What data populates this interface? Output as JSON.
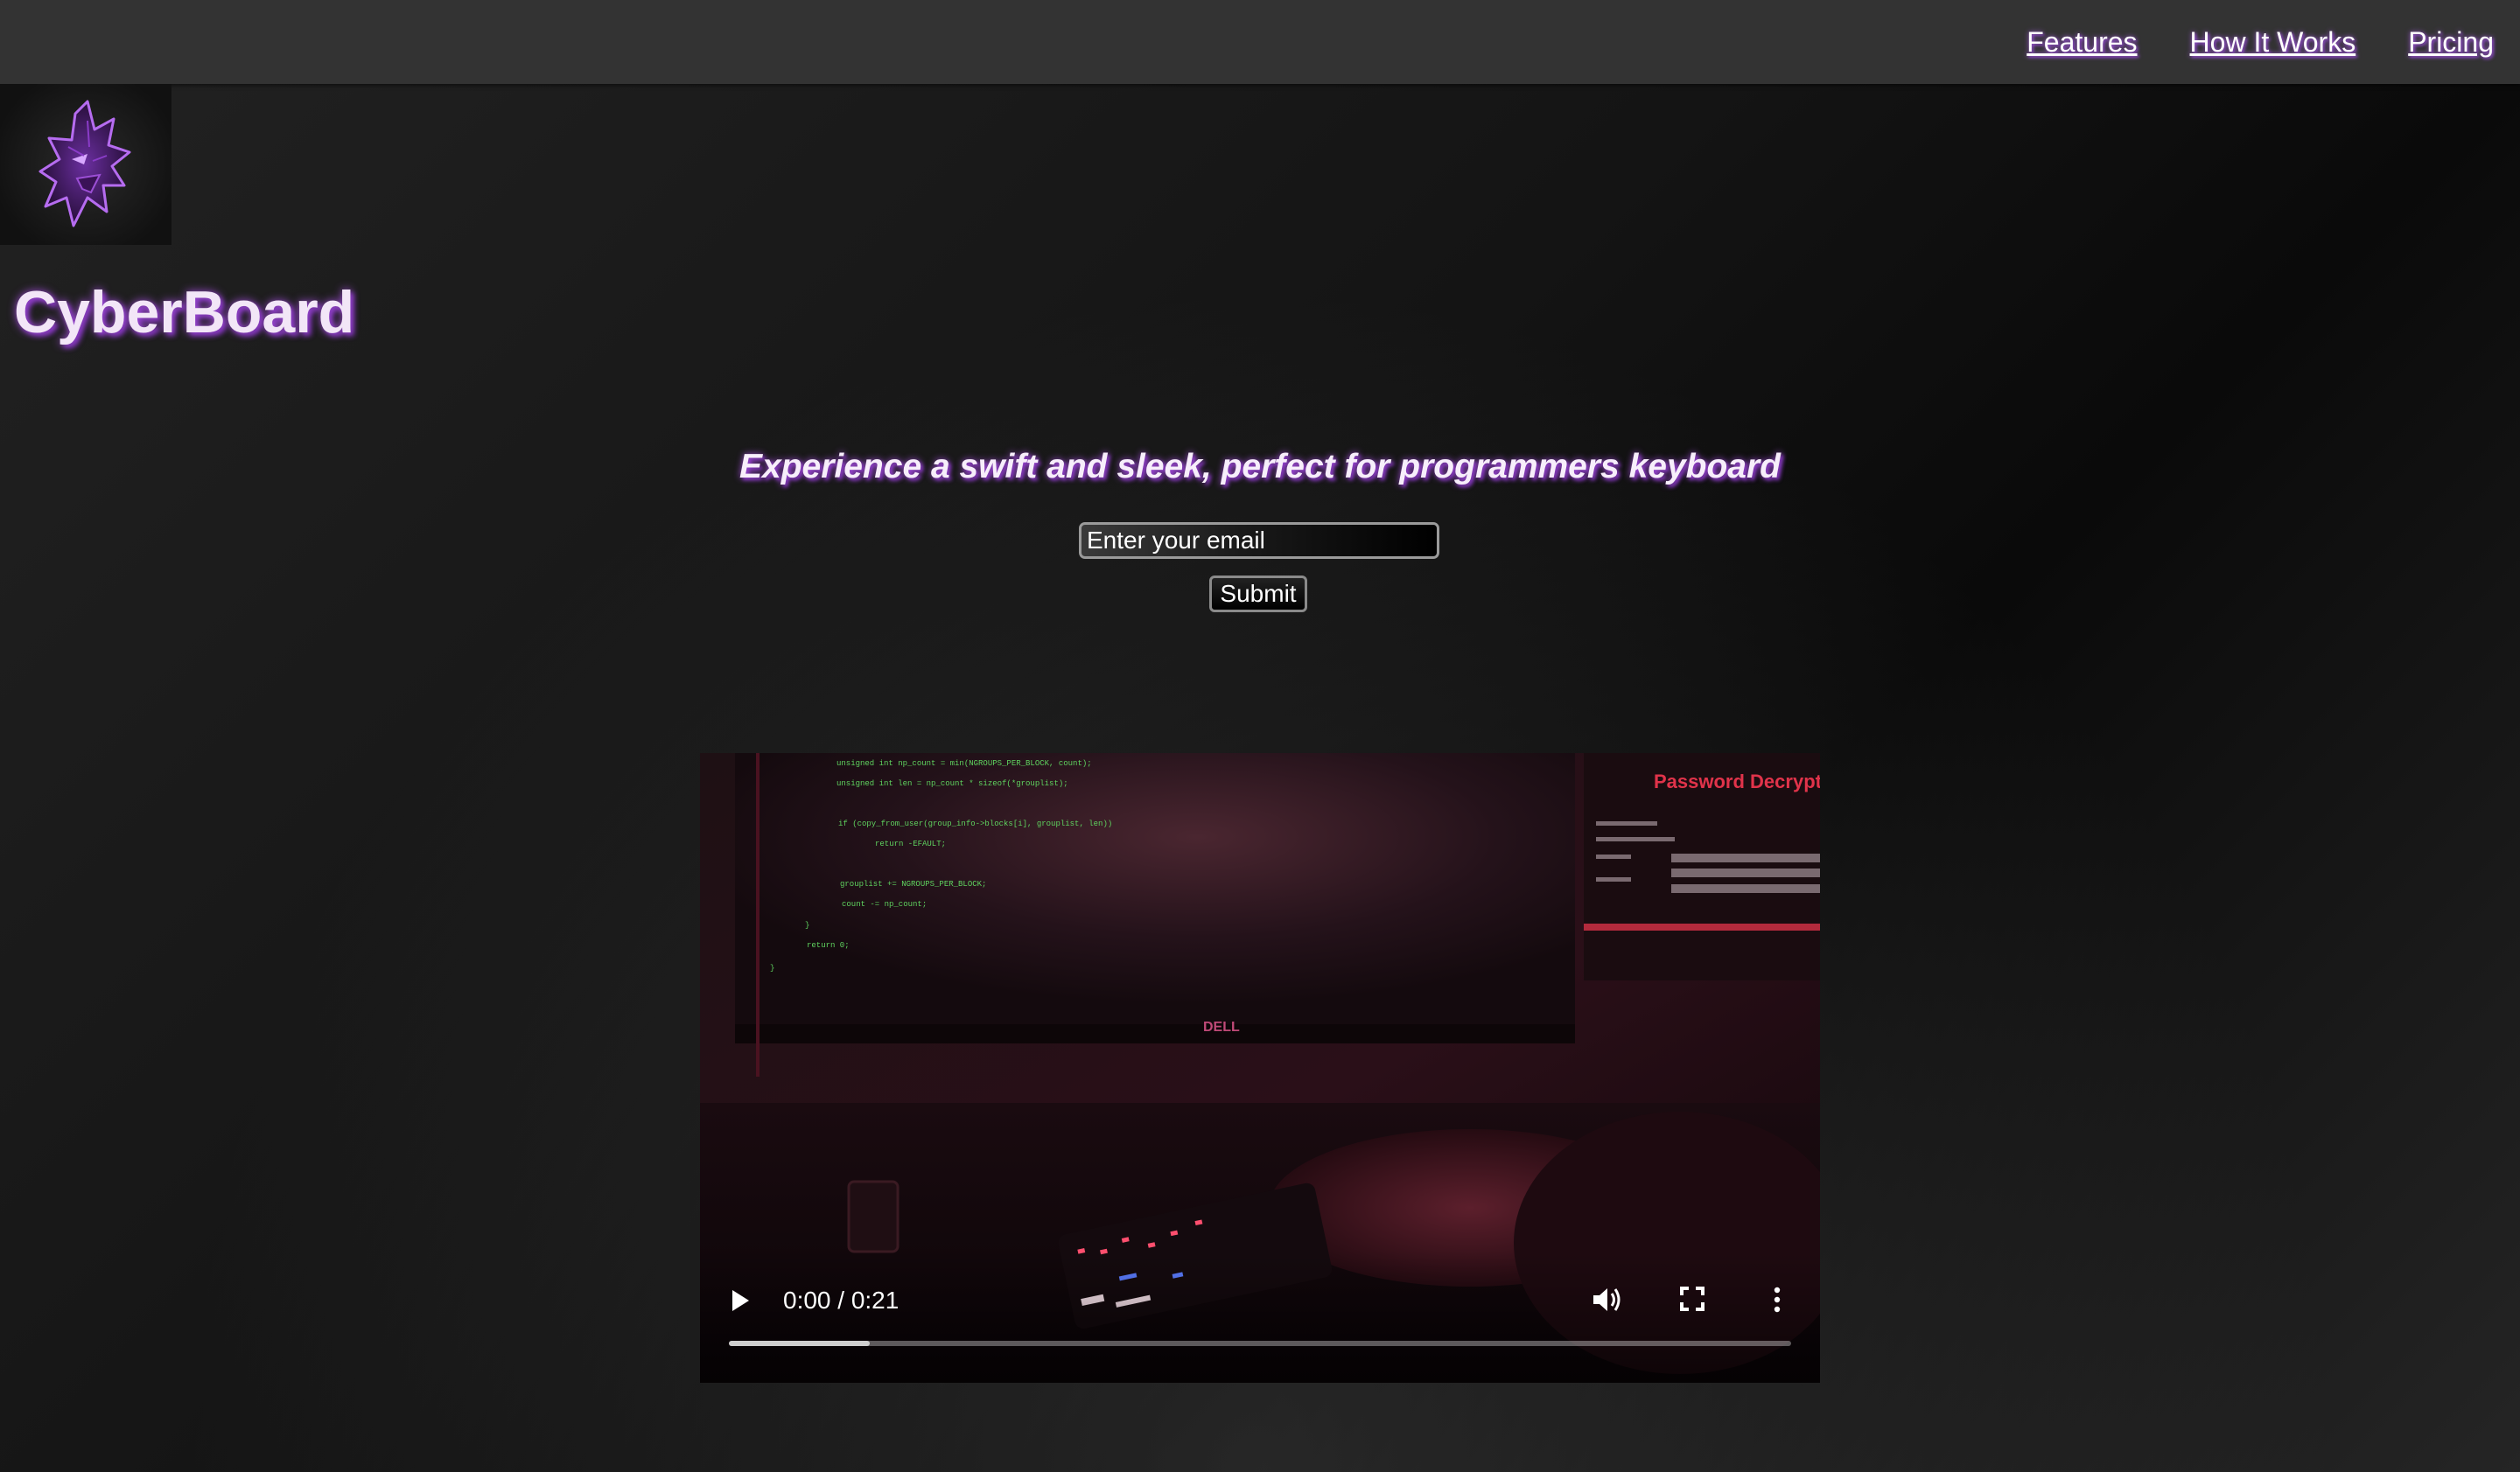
{
  "nav": {
    "items": [
      {
        "label": "Features"
      },
      {
        "label": "How It Works"
      },
      {
        "label": "Pricing"
      }
    ]
  },
  "brand": {
    "name": "CyberBoard",
    "logo_icon": "wolf-logo-icon",
    "accent_color": "#a24fd8"
  },
  "hero": {
    "tagline": "Experience a swift and sleek, perfect for programmers keyboard",
    "email_placeholder": "Enter your email",
    "email_value": "",
    "submit_label": "Submit"
  },
  "video": {
    "time_display": "0:00 / 0:21",
    "buffered_fraction": 0.133,
    "play_icon": "play-icon",
    "volume_icon": "volume-icon",
    "fullscreen_icon": "fullscreen-icon",
    "menu_icon": "more-options-icon",
    "monitor_brand": "DELL",
    "screen_title": "Password Decrypt",
    "code_lines": [
      "unsigned int np_count = min(NGROUPS_PER_BLOCK, count);",
      "unsigned int len = np_count * sizeof(*grouplist);",
      "if (copy_from_user(group_info->blocks[i], grouplist, len))",
      "return -EFAULT;",
      "grouplist += NGROUPS_PER_BLOCK;",
      "count -= np_count;",
      "}",
      "return 0;",
      "}"
    ]
  }
}
